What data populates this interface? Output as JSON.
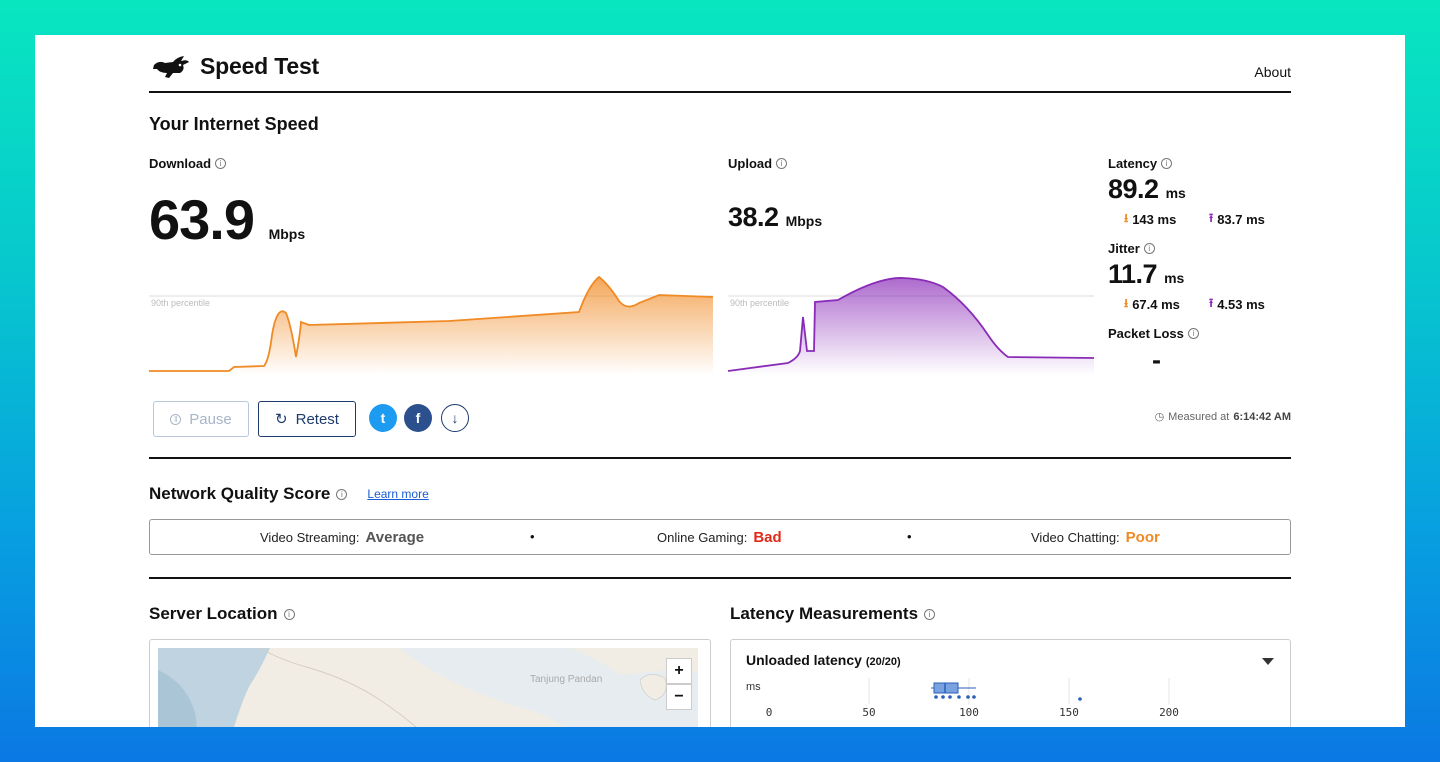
{
  "app": {
    "title": "Speed Test",
    "about_label": "About"
  },
  "section_speed": {
    "title": "Your Internet Speed"
  },
  "download": {
    "label": "Download",
    "value": "63.9",
    "unit": "Mbps",
    "percentile_label": "90th percentile",
    "color": "#f08a24"
  },
  "upload": {
    "label": "Upload",
    "value": "38.2",
    "unit": "Mbps",
    "percentile_label": "90th percentile",
    "color": "#8a2bb8"
  },
  "latency": {
    "label": "Latency",
    "value": "89.2",
    "unit": "ms",
    "down": "143 ms",
    "up": "83.7 ms"
  },
  "jitter": {
    "label": "Jitter",
    "value": "11.7",
    "unit": "ms",
    "down": "67.4 ms",
    "up": "4.53 ms"
  },
  "packet_loss": {
    "label": "Packet Loss",
    "value": "-"
  },
  "actions": {
    "pause_label": "Pause",
    "retest_label": "Retest",
    "twitter_glyph": "t",
    "facebook_glyph": "f",
    "download_glyph": "↓"
  },
  "measured": {
    "prefix": "Measured at",
    "time": "6:14:42 AM"
  },
  "network_quality": {
    "title": "Network Quality Score",
    "learn_more": "Learn more",
    "items": [
      {
        "label": "Video Streaming:",
        "value": "Average",
        "color": "#555555"
      },
      {
        "label": "Online Gaming:",
        "value": "Bad",
        "color": "#e02a1a"
      },
      {
        "label": "Video Chatting:",
        "value": "Poor",
        "color": "#f08a24"
      }
    ],
    "separator": "•"
  },
  "server_location": {
    "title": "Server Location",
    "map_label": "Tanjung Pandan",
    "zoom_in": "+",
    "zoom_out": "−"
  },
  "latency_measurements": {
    "title": "Latency Measurements",
    "panel_title": "Unloaded latency",
    "panel_count": "(20/20)",
    "axis_unit": "ms",
    "ticks": [
      "0",
      "50",
      "100",
      "150",
      "200"
    ]
  },
  "colors": {
    "accent": "#1e3b6e",
    "download": "#f08a24",
    "upload": "#8a2bb8",
    "link": "#1a5cd6"
  }
}
